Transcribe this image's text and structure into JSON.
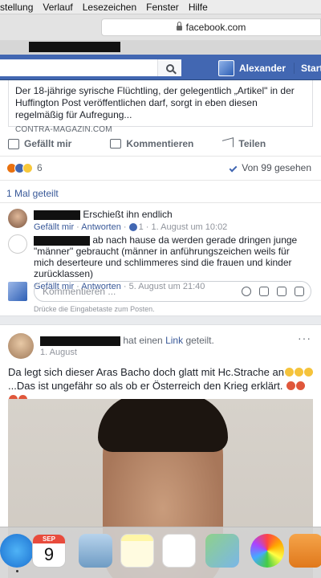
{
  "menubar": [
    "stellung",
    "Verlauf",
    "Lesezeichen",
    "Fenster",
    "Hilfe"
  ],
  "browser": {
    "url": "facebook.com"
  },
  "fb": {
    "user_name": "Alexander",
    "start_label": "Startsei"
  },
  "post1": {
    "link_description": "Der 18-jährige syrische Flüchtling, der gelegentlich „Artikel\" in der Huffington Post veröffentlichen darf, sorgt in eben diesen regelmäßig für Aufregung...",
    "link_domain": "CONTRA-MAGAZIN.COM",
    "like_label": "Gefällt mir",
    "comment_label": "Kommentieren",
    "share_label": "Teilen",
    "reaction_count": "6",
    "seen_by": "Von 99 gesehen",
    "shared_count": "1 Mal geteilt",
    "comments": [
      {
        "text": "Erschießt ihn endlich",
        "like": "Gefällt mir",
        "reply": "Antworten",
        "reactions": "1",
        "date": "1. August um 10:02"
      },
      {
        "text_start": "ab nach hause da werden gerade dringen junge \"männer\"",
        "text_rest": "gebraucht (männer in anführungszeichen weils für mich deserteure und schlimmeres sind die frauen und kinder zurücklassen)",
        "like": "Gefällt mir",
        "reply": "Antworten",
        "date": "5. August um 21:40"
      }
    ],
    "comment_placeholder": "Kommentieren ...",
    "comment_hint": "Drücke die Eingabetaste zum Posten."
  },
  "post2": {
    "header_suffix": "hat einen",
    "header_link": "Link",
    "header_end": "geteilt.",
    "date": "1. August",
    "menu": "···",
    "text_line1": "Da legt sich dieser Aras Bacho doch glatt mit Hc.Strache an",
    "text_line2": "...Das ist ungefähr so als ob er Österreich den Krieg erklärt."
  },
  "dock": {
    "calendar_month": "SEP",
    "calendar_day": "9",
    "icons": [
      "safari-icon",
      "calendar-icon",
      "mail-icon",
      "notes-icon",
      "reminders-icon",
      "maps-icon",
      "photos-icon",
      "pages-icon"
    ]
  },
  "colors": {
    "fb_blue": "#4267b2",
    "link_blue": "#385898",
    "page_bg": "#e9ebee"
  }
}
